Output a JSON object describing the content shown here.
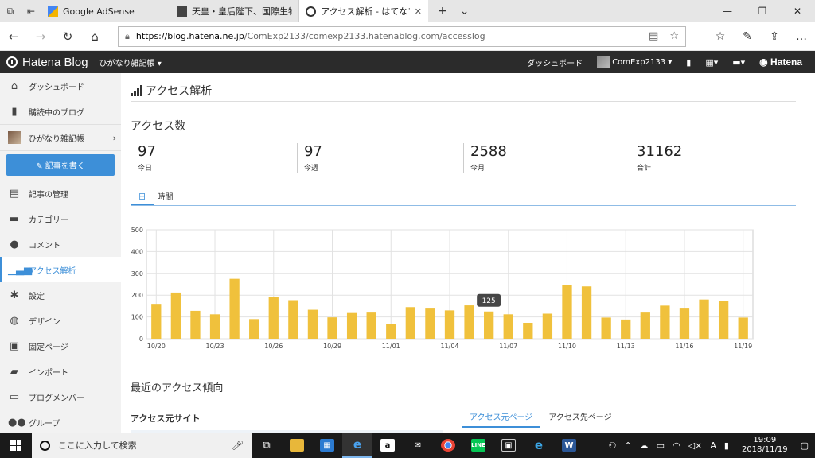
{
  "browser": {
    "tabs": [
      {
        "label": "Google AdSense",
        "fav_color": "#f4b400"
      },
      {
        "label": "天皇・皇后陛下、国際生物学",
        "fav_color": "#444444"
      },
      {
        "label": "アクセス解析 - はてなブロ:",
        "fav_color": "#333333"
      }
    ],
    "url_host": "https://blog.hatena.ne.jp",
    "url_rest": "/ComExp2133/comexp2133.hatenablog.com/accesslog"
  },
  "header": {
    "logo": "Hatena Blog",
    "blog_select": "ひがなり雑記帳 ▾",
    "dashboard": "ダッシュボード",
    "user": "ComExp2133 ▾",
    "brand": "Hatena"
  },
  "sidebar": {
    "items_top": [
      {
        "label": "ダッシュボード",
        "icon": "home-icon"
      },
      {
        "label": "購読中のブログ",
        "icon": "bookmark-icon"
      }
    ],
    "blog": {
      "label": "ひがなり雑記帳"
    },
    "write_label": "✎ 記事を書く",
    "items": [
      {
        "label": "記事の管理",
        "icon": "document-icon"
      },
      {
        "label": "カテゴリー",
        "icon": "folder-icon"
      },
      {
        "label": "コメント",
        "icon": "comment-icon"
      },
      {
        "label": "アクセス解析",
        "icon": "bar-chart-icon",
        "active": true
      },
      {
        "label": "設定",
        "icon": "wrench-icon"
      },
      {
        "label": "デザイン",
        "icon": "palette-icon"
      },
      {
        "label": "固定ページ",
        "icon": "page-icon"
      },
      {
        "label": "インポート",
        "icon": "truck-icon"
      },
      {
        "label": "ブログメンバー",
        "icon": "members-icon"
      },
      {
        "label": "グループ",
        "icon": "group-icon"
      }
    ]
  },
  "main": {
    "page_title": "アクセス解析",
    "section_title": "アクセス数",
    "stats": [
      {
        "value": "97",
        "label": "今日"
      },
      {
        "value": "97",
        "label": "今週"
      },
      {
        "value": "2588",
        "label": "今月"
      },
      {
        "value": "31162",
        "label": "合計"
      }
    ],
    "tabs": [
      "日",
      "時間"
    ],
    "recent_title": "最近のアクセス傾向",
    "source_site": "アクセス元サイト",
    "source_tabs": [
      "アクセス元ページ",
      "アクセス先ページ"
    ]
  },
  "chart_data": {
    "type": "bar",
    "x": [
      "10/20",
      "10/21",
      "10/22",
      "10/23",
      "10/24",
      "10/25",
      "10/26",
      "10/27",
      "10/28",
      "10/29",
      "10/30",
      "10/31",
      "11/01",
      "11/02",
      "11/03",
      "11/04",
      "11/05",
      "11/06",
      "11/07",
      "11/08",
      "11/09",
      "11/10",
      "11/11",
      "11/12",
      "11/13",
      "11/14",
      "11/15",
      "11/16",
      "11/17",
      "11/18",
      "11/19"
    ],
    "x_tick_labels": [
      "10/20",
      "10/23",
      "10/26",
      "10/29",
      "11/01",
      "11/04",
      "11/07",
      "11/10",
      "11/13",
      "11/16",
      "11/19"
    ],
    "values": [
      160,
      212,
      128,
      112,
      275,
      90,
      192,
      177,
      133,
      98,
      118,
      120,
      68,
      145,
      142,
      130,
      153,
      125,
      112,
      73,
      115,
      245,
      240,
      97,
      88,
      120,
      152,
      142,
      180,
      175,
      97
    ],
    "ylim": [
      0,
      500
    ],
    "yticks": [
      0,
      100,
      200,
      300,
      400,
      500
    ],
    "tooltip": "125",
    "tooltip_index": 17,
    "bar_color": "#f0c13c",
    "grid": true
  },
  "taskbar": {
    "search_placeholder": "ここに入力して検索",
    "time": "19:09",
    "date": "2018/11/19",
    "ime": "A"
  }
}
